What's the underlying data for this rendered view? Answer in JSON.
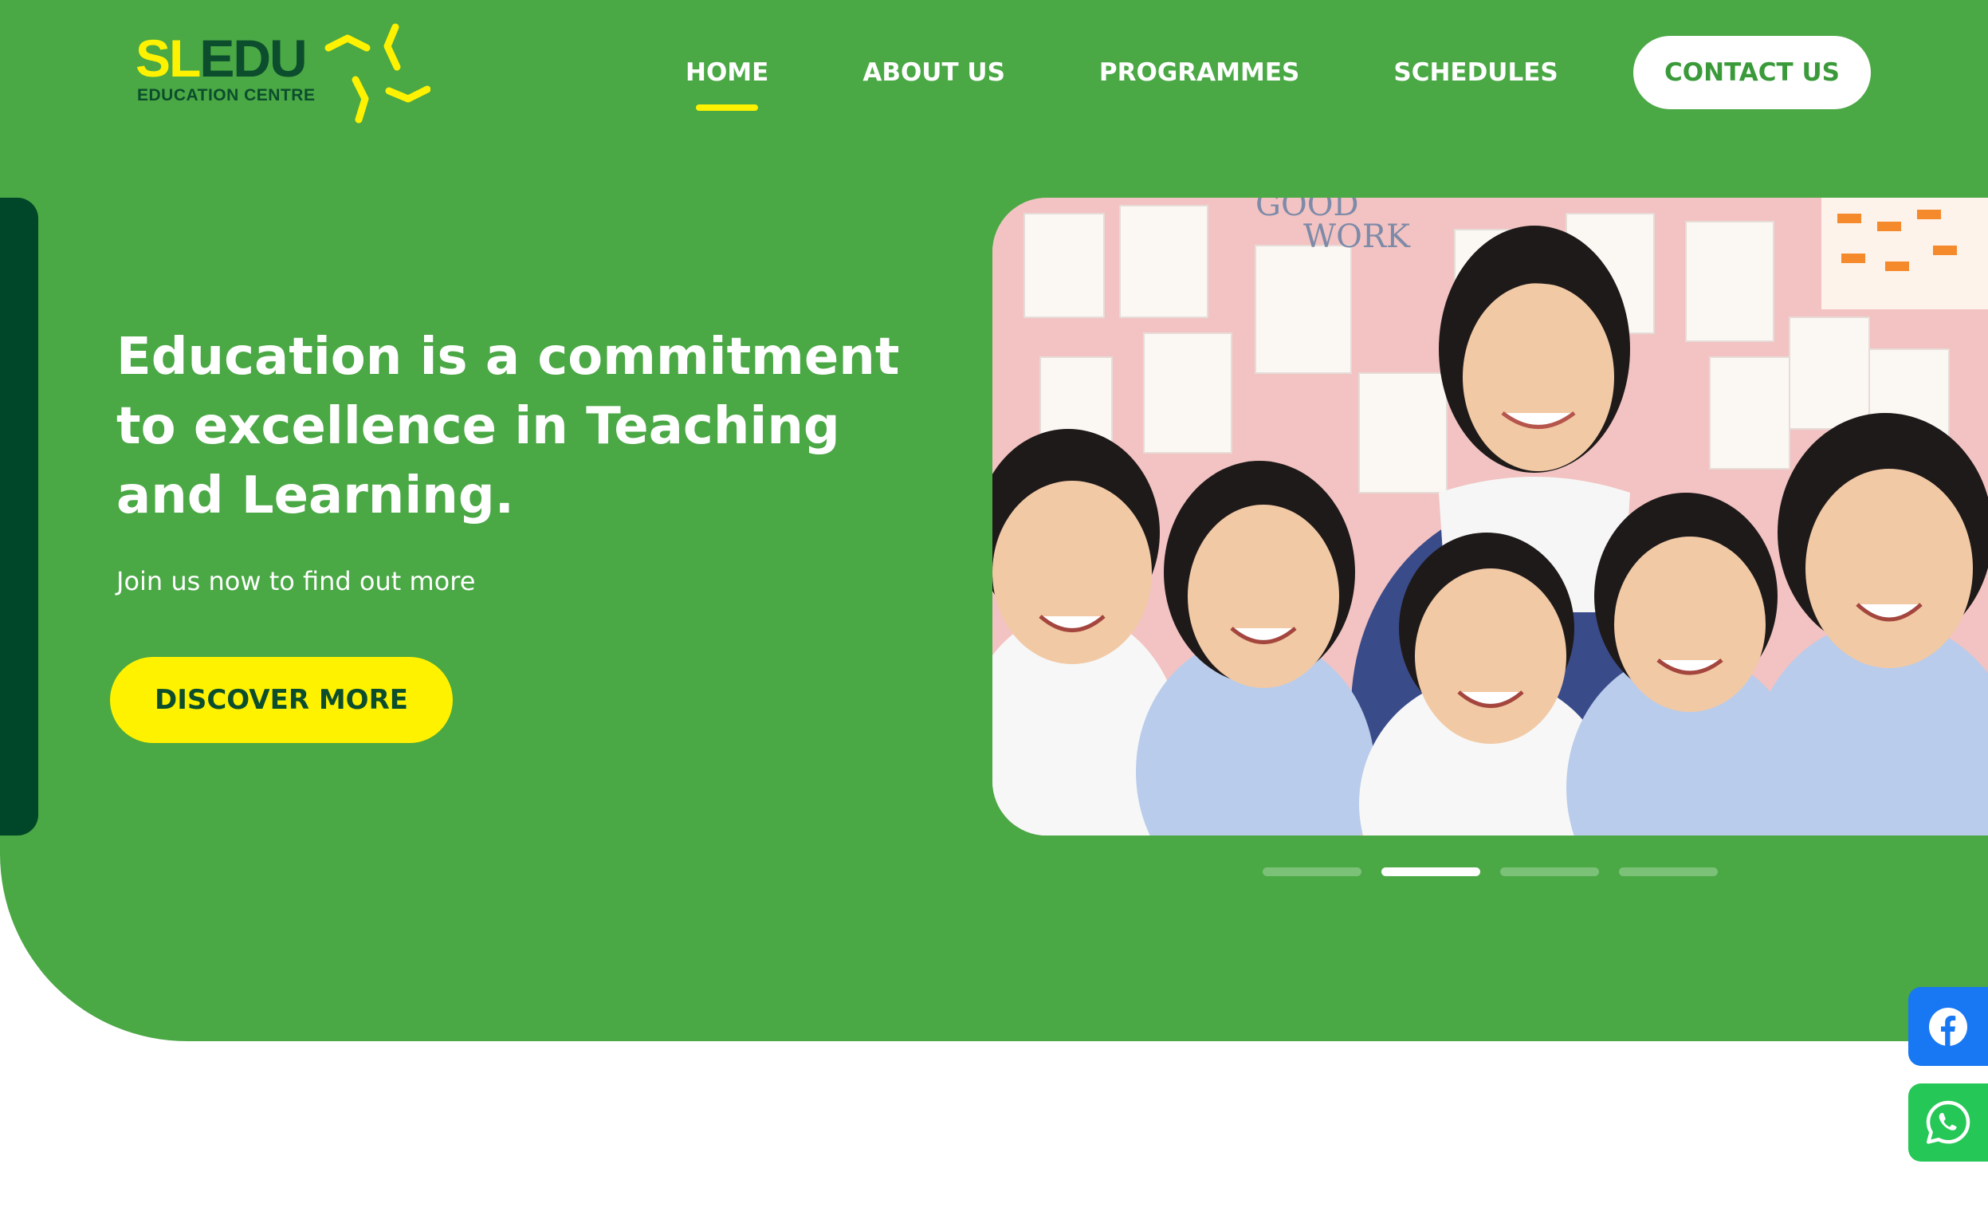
{
  "brand": {
    "logo_main_1": "SL",
    "logo_main_2": "EDU",
    "logo_sub": "EDUCATION CENTRE"
  },
  "nav": {
    "items": [
      {
        "label": "HOME",
        "active": true
      },
      {
        "label": "ABOUT US",
        "active": false
      },
      {
        "label": "PROGRAMMES",
        "active": false
      },
      {
        "label": "SCHEDULES",
        "active": false
      }
    ],
    "contact_label": "CONTACT US"
  },
  "hero": {
    "headline_line1": "Education is a commitment",
    "headline_line2": "to excellence in Teaching",
    "headline_line3": "and Learning.",
    "subline": "Join us now to find out more",
    "cta_label": "DISCOVER MORE",
    "photo_board_text_1": "GOOD",
    "photo_board_text_2": "WORK"
  },
  "carousel": {
    "slide_count": 4,
    "active_index": 1
  },
  "social": {
    "facebook_icon": "facebook-icon",
    "whatsapp_icon": "whatsapp-icon"
  },
  "colors": {
    "hero_green": "#4aa845",
    "dark_green": "#004628",
    "accent_yellow": "#fff200",
    "facebook_blue": "#1877f2",
    "whatsapp_green": "#25c756"
  }
}
